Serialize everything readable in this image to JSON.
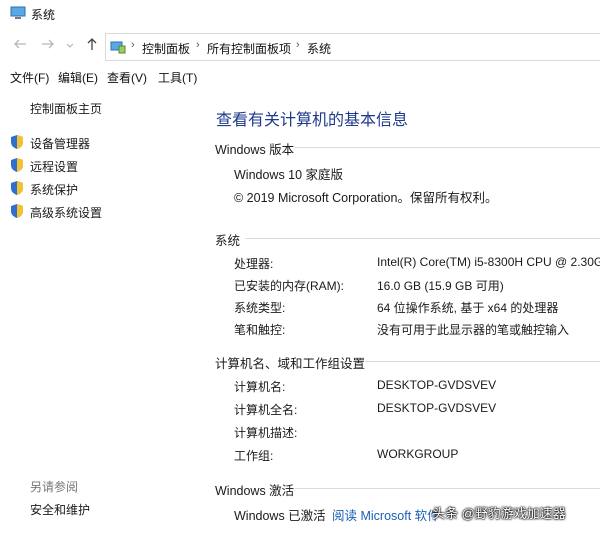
{
  "window": {
    "title": "系统"
  },
  "nav": {
    "back_icon": "arrow-left-icon",
    "forward_icon": "arrow-right-icon",
    "history_icon": "chevron-down-icon",
    "up_icon": "arrow-up-icon",
    "breadcrumbs": [
      "控制面板",
      "所有控制面板项",
      "系统"
    ],
    "separator": "›"
  },
  "menu": [
    "文件(F)",
    "编辑(E)",
    "查看(V)",
    "工具(T)"
  ],
  "sidebar": {
    "home": "控制面板主页",
    "links": [
      {
        "label": "设备管理器",
        "icon": "shield-icon"
      },
      {
        "label": "远程设置",
        "icon": "shield-icon"
      },
      {
        "label": "系统保护",
        "icon": "shield-icon"
      },
      {
        "label": "高级系统设置",
        "icon": "shield-icon"
      }
    ],
    "see_also": "另请参阅",
    "security": "安全和维护"
  },
  "main": {
    "title": "查看有关计算机的基本信息",
    "edition": {
      "heading": "Windows 版本",
      "name": "Windows 10 家庭版",
      "copyright": "© 2019 Microsoft Corporation。保留所有权利。"
    },
    "system": {
      "heading": "系统",
      "rows": [
        {
          "k": "处理器:",
          "v": "Intel(R) Core(TM) i5-8300H CPU @ 2.30G"
        },
        {
          "k": "已安装的内存(RAM):",
          "v": "16.0 GB (15.9 GB 可用)"
        },
        {
          "k": "系统类型:",
          "v": "64 位操作系统, 基于 x64 的处理器"
        },
        {
          "k": "笔和触控:",
          "v": "没有可用于此显示器的笔或触控输入"
        }
      ]
    },
    "computer": {
      "heading": "计算机名、域和工作组设置",
      "rows": [
        {
          "k": "计算机名:",
          "v": "DESKTOP-GVDSVEV"
        },
        {
          "k": "计算机全名:",
          "v": "DESKTOP-GVDSVEV"
        },
        {
          "k": "计算机描述:",
          "v": ""
        },
        {
          "k": "工作组:",
          "v": "WORKGROUP"
        }
      ]
    },
    "activation": {
      "heading": "Windows 激活",
      "status": "Windows 已激活",
      "link": "阅读 Microsoft 软件"
    }
  },
  "watermark": "头条 @野豹游戏加速器"
}
